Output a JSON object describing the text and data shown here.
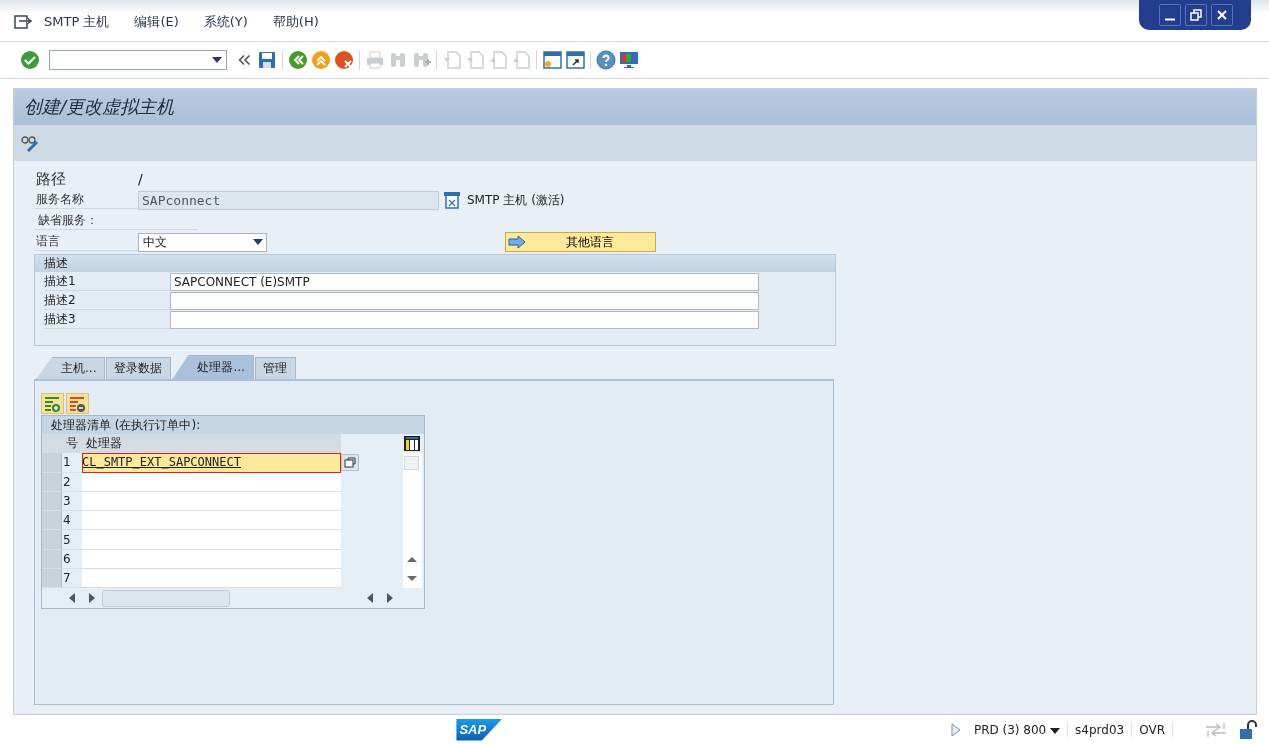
{
  "menu": [
    {
      "label": "SMTP 主机"
    },
    {
      "label": "编辑(E)"
    },
    {
      "label": "系统(Y)"
    },
    {
      "label": "帮助(H)"
    }
  ],
  "toolbar": [
    {
      "kind": "enter",
      "disabled": false
    },
    {
      "kind": "command",
      "disabled": false
    },
    {
      "kind": "chevrons",
      "disabled": false
    },
    {
      "kind": "save",
      "disabled": false
    },
    {
      "kind": "sep"
    },
    {
      "kind": "back",
      "disabled": false
    },
    {
      "kind": "exit",
      "disabled": false
    },
    {
      "kind": "cancel",
      "disabled": false
    },
    {
      "kind": "sep"
    },
    {
      "kind": "print",
      "disabled": true
    },
    {
      "kind": "find",
      "disabled": true
    },
    {
      "kind": "findnext",
      "disabled": true
    },
    {
      "kind": "sep"
    },
    {
      "kind": "first",
      "disabled": true
    },
    {
      "kind": "prev",
      "disabled": true
    },
    {
      "kind": "next",
      "disabled": true
    },
    {
      "kind": "last",
      "disabled": true
    },
    {
      "kind": "sep"
    },
    {
      "kind": "newsession",
      "disabled": false
    },
    {
      "kind": "shortcut",
      "disabled": false
    },
    {
      "kind": "sep"
    },
    {
      "kind": "help",
      "disabled": false
    },
    {
      "kind": "layout",
      "disabled": false
    }
  ],
  "screen_title": "创建/更改虚拟主机",
  "form": {
    "path": {
      "label": "路径",
      "value": "/"
    },
    "service": {
      "label": "服务名称",
      "value": "SAPconnect",
      "status": "SMTP 主机 (激活)"
    },
    "default_service": {
      "label": "缺省服务："
    },
    "language": {
      "label": "语言",
      "value": "中文"
    },
    "other_languages_button": "其他语言"
  },
  "description": {
    "title": "描述",
    "rows": [
      {
        "label": "描述1",
        "value": "SAPCONNECT (E)SMTP"
      },
      {
        "label": "描述2"
      },
      {
        "label": "描述3"
      }
    ]
  },
  "tabs": [
    {
      "label": "主机...",
      "selected": false
    },
    {
      "label": "登录数据",
      "selected": false
    },
    {
      "label": "处理器...",
      "selected": true
    },
    {
      "label": "管理",
      "selected": false
    }
  ],
  "handler_table": {
    "title": "处理器清单 (在执行订单中):",
    "columns": [
      "号",
      "处理器"
    ],
    "rows": [
      {
        "number": "1",
        "value": "CL_SMTP_EXT_SAPCONNECT",
        "selected": true
      },
      {
        "number": "2",
        "selected": false
      },
      {
        "number": "3",
        "selected": false
      },
      {
        "number": "4",
        "selected": false
      },
      {
        "number": "5",
        "selected": false
      },
      {
        "number": "6",
        "selected": false
      },
      {
        "number": "7",
        "selected": false
      }
    ]
  },
  "status_bar": {
    "logo": "SAP",
    "system": "PRD (3) 800",
    "server": "s4prd03",
    "mode": "OVR"
  }
}
